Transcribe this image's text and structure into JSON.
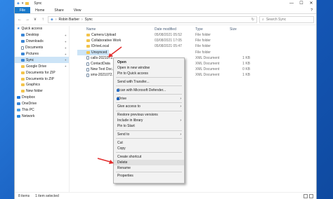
{
  "window": {
    "title": "Sync",
    "caption_min": "—",
    "caption_max": "☐",
    "caption_close": "✕"
  },
  "ribbon": {
    "tabs": [
      "File",
      "Home",
      "Share",
      "View"
    ],
    "help": "?"
  },
  "address": {
    "back": "←",
    "forward": "→",
    "up_history": "∨",
    "up": "↑",
    "crumbs": [
      "Robin Barber",
      "Sync"
    ],
    "refresh": "↻",
    "search_placeholder": "Search Sync"
  },
  "nav": {
    "items": [
      {
        "label": "Quick access",
        "icon": "star",
        "pinned": false
      },
      {
        "label": "Desktop",
        "icon": "blue",
        "pinned": true
      },
      {
        "label": "Downloads",
        "icon": "blue",
        "pinned": true
      },
      {
        "label": "Documents",
        "icon": "doc",
        "pinned": true
      },
      {
        "label": "Pictures",
        "icon": "blue",
        "pinned": true
      },
      {
        "label": "Sync",
        "icon": "blue",
        "pinned": true,
        "selected": true
      },
      {
        "label": "Google Drive",
        "icon": "folder",
        "pinned": true
      },
      {
        "label": "Documents for ZIP",
        "icon": "folder",
        "pinned": false
      },
      {
        "label": "Documents to ZIP",
        "icon": "folder",
        "pinned": false
      },
      {
        "label": "Graphics",
        "icon": "folder",
        "pinned": false
      },
      {
        "label": "New folder",
        "icon": "folder",
        "pinned": false
      },
      {
        "label": "Dropbox",
        "icon": "drop",
        "pinned": false
      },
      {
        "label": "OneDrive",
        "icon": "blue",
        "pinned": false
      },
      {
        "label": "This PC",
        "icon": "pc",
        "pinned": false
      },
      {
        "label": "Network",
        "icon": "net",
        "pinned": false
      }
    ],
    "pin_glyph": "✦"
  },
  "columns": {
    "name": "Name",
    "date": "Date modified",
    "type": "Type",
    "size": "Size"
  },
  "files": [
    {
      "name": "Camera Upload",
      "date": "05/08/2021 05:52",
      "type": "File folder",
      "size": "",
      "icon": "folder"
    },
    {
      "name": "Collaborative Work",
      "date": "03/08/2021 17:05",
      "type": "File folder",
      "size": "",
      "icon": "folder"
    },
    {
      "name": "IDriveLocal",
      "date": "05/08/2021 05:47",
      "type": "File folder",
      "size": "",
      "icon": "folder"
    },
    {
      "name": "Unsynced",
      "date": "",
      "type": "File folder",
      "size": "",
      "icon": "folder",
      "selected": true
    },
    {
      "name": "calls-2021072...",
      "date": "",
      "type": "XML Document",
      "size": "1 KB",
      "icon": "doc"
    },
    {
      "name": "ContactData",
      "date": "",
      "type": "XML Document",
      "size": "1 KB",
      "icon": "doc"
    },
    {
      "name": "New Text Doc...",
      "date": "",
      "type": "XML Document",
      "size": "0 KB",
      "icon": "doc"
    },
    {
      "name": "sms-2021072...",
      "date": "",
      "type": "XML Document",
      "size": "1 KB",
      "icon": "doc"
    }
  ],
  "status": {
    "items": "8 items",
    "selected": "1 item selected"
  },
  "context_menu": {
    "items": [
      {
        "label": "Open",
        "bold": true
      },
      {
        "label": "Open in new window"
      },
      {
        "label": "Pin to Quick access"
      },
      {
        "sep": true
      },
      {
        "label": "Send with Transfer..."
      },
      {
        "sep": true
      },
      {
        "label": "Scan with Microsoft Defender...",
        "icon": "#2b6fc4"
      },
      {
        "sep": true
      },
      {
        "label": "IDrive",
        "icon": "#1a5fb8",
        "submenu": true
      },
      {
        "sep": true
      },
      {
        "label": "Give access to",
        "submenu": true
      },
      {
        "sep": true
      },
      {
        "label": "Restore previous versions"
      },
      {
        "label": "Include in library",
        "submenu": true
      },
      {
        "label": "Pin to Start"
      },
      {
        "sep": true
      },
      {
        "label": "Send to",
        "submenu": true
      },
      {
        "sep": true
      },
      {
        "label": "Cut"
      },
      {
        "label": "Copy"
      },
      {
        "sep": true
      },
      {
        "label": "Create shortcut"
      },
      {
        "label": "Delete",
        "highlight": true
      },
      {
        "label": "Rename"
      },
      {
        "sep": true
      },
      {
        "label": "Properties"
      }
    ],
    "submenu_glyph": "›"
  },
  "colors": {
    "accent": "#1979ca",
    "selection": "#cce4f7",
    "annotation_arrow": "#e32b2b"
  }
}
